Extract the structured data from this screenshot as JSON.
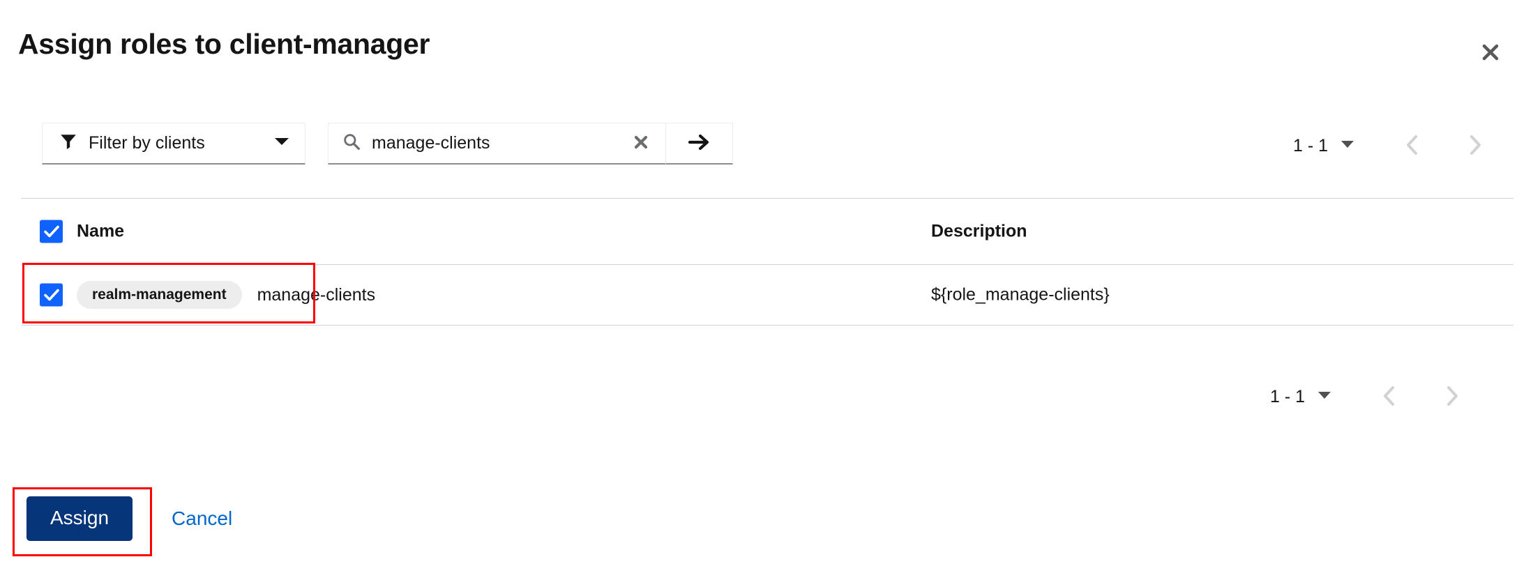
{
  "modal": {
    "title": "Assign roles to client-manager",
    "close_icon": "close-icon"
  },
  "toolbar": {
    "filter": {
      "icon": "filter-icon",
      "label": "Filter by clients",
      "caret_icon": "chevron-down-icon"
    },
    "search": {
      "icon": "search-icon",
      "value": "manage-clients",
      "placeholder": "Search",
      "clear_icon": "close-icon",
      "submit_icon": "arrow-right-icon"
    }
  },
  "pagination": {
    "top": {
      "range": "1 - 1",
      "caret_icon": "caret-down-icon",
      "prev_icon": "chevron-left-icon",
      "next_icon": "chevron-right-icon"
    },
    "bottom": {
      "range": "1 - 1",
      "caret_icon": "caret-down-icon",
      "prev_icon": "chevron-left-icon",
      "next_icon": "chevron-right-icon"
    }
  },
  "table": {
    "columns": {
      "name": "Name",
      "description": "Description"
    },
    "select_all_checked": true,
    "rows": [
      {
        "checked": true,
        "client_badge": "realm-management",
        "role_name": "manage-clients",
        "description": "${role_manage-clients}"
      }
    ]
  },
  "footer": {
    "assign_label": "Assign",
    "cancel_label": "Cancel"
  },
  "colors": {
    "checkbox_blue": "#0f62fe",
    "primary_button": "#06357a",
    "link_blue": "#0066cc",
    "annotation_red": "#ff0000",
    "badge_gray": "#ededed",
    "border_gray": "#d2d2d2"
  }
}
